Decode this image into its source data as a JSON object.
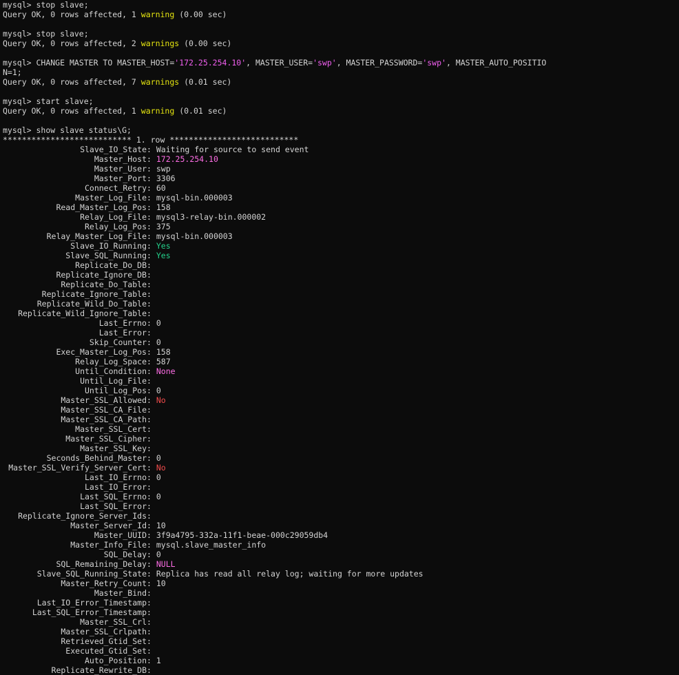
{
  "terminal": {
    "prompt": "mysql>",
    "blocks": [
      {
        "cmd": "stop slave;",
        "result_pre": "Query OK, 0 rows affected, 1 ",
        "warn": "warning",
        "result_post": " (0.00 sec)"
      },
      {
        "cmd": "stop slave;",
        "result_pre": "Query OK, 0 rows affected, 2 ",
        "warn": "warnings",
        "result_post": " (0.00 sec)"
      },
      {
        "cmd_pre": "CHANGE MASTER TO MASTER_HOST=",
        "cmd_str1": "'172.25.254.10'",
        "cmd_mid1": ", MASTER_USER=",
        "cmd_str2": "'swp'",
        "cmd_mid2": ", MASTER_PASSWORD=",
        "cmd_str3": "'swp'",
        "cmd_post": ", MASTER_AUTO_POSITIO",
        "cmd_cont": "N=1;",
        "result_pre": "Query OK, 0 rows affected, 7 ",
        "warn": "warnings",
        "result_post": " (0.01 sec)"
      },
      {
        "cmd": "start slave;",
        "result_pre": "Query OK, 0 rows affected, 1 ",
        "warn": "warning",
        "result_post": " (0.01 sec)"
      }
    ],
    "status_cmd": "show slave status\\G;",
    "row_header": "*************************** 1. row ***************************",
    "status": [
      {
        "k": "Slave_IO_State",
        "v": "Waiting for source to send event",
        "c": "p"
      },
      {
        "k": "Master_Host",
        "v": "172.25.254.10",
        "c": "m"
      },
      {
        "k": "Master_User",
        "v": "swp",
        "c": "p"
      },
      {
        "k": "Master_Port",
        "v": "3306",
        "c": "p"
      },
      {
        "k": "Connect_Retry",
        "v": "60",
        "c": "p"
      },
      {
        "k": "Master_Log_File",
        "v": "mysql-bin.000003",
        "c": "p"
      },
      {
        "k": "Read_Master_Log_Pos",
        "v": "158",
        "c": "p"
      },
      {
        "k": "Relay_Log_File",
        "v": "mysql3-relay-bin.000002",
        "c": "p"
      },
      {
        "k": "Relay_Log_Pos",
        "v": "375",
        "c": "p"
      },
      {
        "k": "Relay_Master_Log_File",
        "v": "mysql-bin.000003",
        "c": "p"
      },
      {
        "k": "Slave_IO_Running",
        "v": "Yes",
        "c": "g"
      },
      {
        "k": "Slave_SQL_Running",
        "v": "Yes",
        "c": "g"
      },
      {
        "k": "Replicate_Do_DB",
        "v": "",
        "c": "p"
      },
      {
        "k": "Replicate_Ignore_DB",
        "v": "",
        "c": "p"
      },
      {
        "k": "Replicate_Do_Table",
        "v": "",
        "c": "p"
      },
      {
        "k": "Replicate_Ignore_Table",
        "v": "",
        "c": "p"
      },
      {
        "k": "Replicate_Wild_Do_Table",
        "v": "",
        "c": "p"
      },
      {
        "k": "Replicate_Wild_Ignore_Table",
        "v": "",
        "c": "p"
      },
      {
        "k": "Last_Errno",
        "v": "0",
        "c": "p"
      },
      {
        "k": "Last_Error",
        "v": "",
        "c": "p"
      },
      {
        "k": "Skip_Counter",
        "v": "0",
        "c": "p"
      },
      {
        "k": "Exec_Master_Log_Pos",
        "v": "158",
        "c": "p"
      },
      {
        "k": "Relay_Log_Space",
        "v": "587",
        "c": "p"
      },
      {
        "k": "Until_Condition",
        "v": "None",
        "c": "m"
      },
      {
        "k": "Until_Log_File",
        "v": "",
        "c": "p"
      },
      {
        "k": "Until_Log_Pos",
        "v": "0",
        "c": "p"
      },
      {
        "k": "Master_SSL_Allowed",
        "v": "No",
        "c": "r"
      },
      {
        "k": "Master_SSL_CA_File",
        "v": "",
        "c": "p"
      },
      {
        "k": "Master_SSL_CA_Path",
        "v": "",
        "c": "p"
      },
      {
        "k": "Master_SSL_Cert",
        "v": "",
        "c": "p"
      },
      {
        "k": "Master_SSL_Cipher",
        "v": "",
        "c": "p"
      },
      {
        "k": "Master_SSL_Key",
        "v": "",
        "c": "p"
      },
      {
        "k": "Seconds_Behind_Master",
        "v": "0",
        "c": "p"
      },
      {
        "k": "Master_SSL_Verify_Server_Cert",
        "v": "No",
        "c": "r"
      },
      {
        "k": "Last_IO_Errno",
        "v": "0",
        "c": "p"
      },
      {
        "k": "Last_IO_Error",
        "v": "",
        "c": "p"
      },
      {
        "k": "Last_SQL_Errno",
        "v": "0",
        "c": "p"
      },
      {
        "k": "Last_SQL_Error",
        "v": "",
        "c": "p"
      },
      {
        "k": "Replicate_Ignore_Server_Ids",
        "v": "",
        "c": "p"
      },
      {
        "k": "Master_Server_Id",
        "v": "10",
        "c": "p"
      },
      {
        "k": "Master_UUID",
        "v": "3f9a4795-332a-11f1-beae-000c29059db4",
        "c": "p"
      },
      {
        "k": "Master_Info_File",
        "v": "mysql.slave_master_info",
        "c": "p"
      },
      {
        "k": "SQL_Delay",
        "v": "0",
        "c": "p"
      },
      {
        "k": "SQL_Remaining_Delay",
        "v": "NULL",
        "c": "m"
      },
      {
        "k": "Slave_SQL_Running_State",
        "v": "Replica has read all relay log; waiting for more updates",
        "c": "p"
      },
      {
        "k": "Master_Retry_Count",
        "v": "10",
        "c": "p"
      },
      {
        "k": "Master_Bind",
        "v": "",
        "c": "p"
      },
      {
        "k": "Last_IO_Error_Timestamp",
        "v": "",
        "c": "p"
      },
      {
        "k": "Last_SQL_Error_Timestamp",
        "v": "",
        "c": "p"
      },
      {
        "k": "Master_SSL_Crl",
        "v": "",
        "c": "p"
      },
      {
        "k": "Master_SSL_Crlpath",
        "v": "",
        "c": "p"
      },
      {
        "k": "Retrieved_Gtid_Set",
        "v": "",
        "c": "p"
      },
      {
        "k": "Executed_Gtid_Set",
        "v": "",
        "c": "p"
      },
      {
        "k": "Auto_Position",
        "v": "1",
        "c": "p"
      },
      {
        "k": "Replicate_Rewrite_DB",
        "v": "",
        "c": "p"
      }
    ],
    "colors": {
      "background": "#0c0c0c",
      "text": "#d4d4d4",
      "warning": "#e5e510",
      "magenta": "#ff6ee6",
      "string": "#f25ff0",
      "green": "#23d18b",
      "red": "#f14c4c"
    }
  }
}
